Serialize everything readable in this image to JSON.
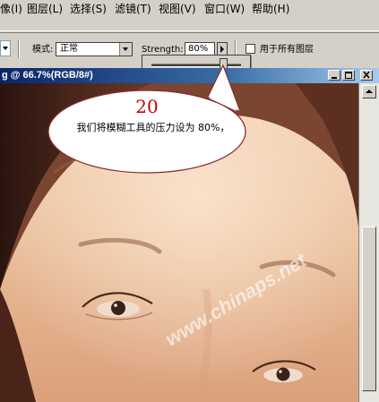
{
  "menu": {
    "items": [
      "像(I)",
      "图层(L)",
      "选择(S)",
      "滤镜(T)",
      "视图(V)",
      "窗口(W)",
      "帮助(H)"
    ]
  },
  "options": {
    "mode_label": "模式:",
    "mode_value": "正常",
    "strength_label": "Strength:",
    "strength_value": "80%",
    "strength_level": 0.8,
    "sample_all_layers_label": "用于所有图层",
    "sample_all_layers_checked": false
  },
  "document": {
    "title": "g @ 66.7%(RGB/8#)"
  },
  "annotation": {
    "step": "20",
    "text": "我们将模糊工具的压力设为 80%，"
  },
  "watermark": "www.chinaps.net",
  "colors": {
    "title_bar": "#0a246a",
    "step_number": "#cc0000",
    "menu_background": "#d4d0c8"
  }
}
